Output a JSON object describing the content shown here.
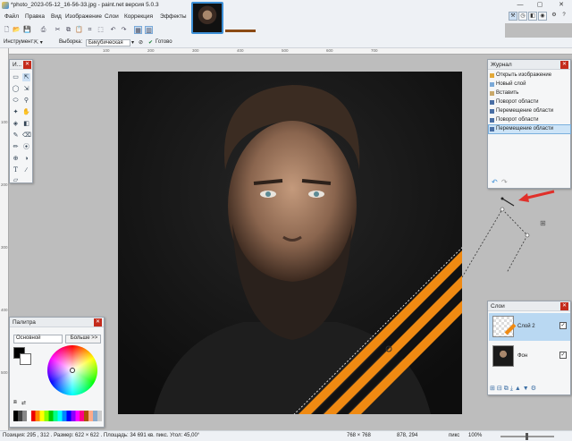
{
  "window": {
    "title": "*photo_2023-05-12_16-56-33.jpg - paint.net версия 5.0.3",
    "min": "—",
    "max": "▢",
    "close": "✕"
  },
  "menu": [
    "Файл",
    "Правка",
    "Вид",
    "Изображение",
    "Слои",
    "Коррекция",
    "Эффекты"
  ],
  "toolbar2": {
    "tool_label": "Инструмент:",
    "tool_value": "⇱ ▾",
    "selection_label": "Выборка:",
    "selection_value": "Бикубическая",
    "done_label": "Готово"
  },
  "history": {
    "title": "Журнал",
    "items": [
      {
        "label": "Открыть изображение",
        "icon": "open-image-icon"
      },
      {
        "label": "Новый слой",
        "icon": "new-layer-icon"
      },
      {
        "label": "Вставить",
        "icon": "paste-icon"
      },
      {
        "label": "Поворот области",
        "icon": "rotate-icon"
      },
      {
        "label": "Перемещение области",
        "icon": "move-icon"
      },
      {
        "label": "Поворот области",
        "icon": "rotate-icon"
      },
      {
        "label": "Перемещение области",
        "icon": "move-icon",
        "selected": true
      }
    ]
  },
  "tools_panel": {
    "title": "И..."
  },
  "layers": {
    "title": "Слои",
    "items": [
      {
        "name": "Слой 2",
        "visible": true,
        "selected": true
      },
      {
        "name": "Фон",
        "visible": true,
        "selected": false
      }
    ]
  },
  "palette": {
    "title": "Палитра",
    "mode": "Основной",
    "more": "Больше >>",
    "primary": "#000000",
    "secondary": "#ffffff"
  },
  "status": {
    "left": "Позиция: 295 , 312 . Размер: 622 × 622 . Площадь: 34 691 кв. пикс. Угол: 45,00°",
    "image_size": "768 × 768",
    "cursor_pos": "878, 294",
    "units": "пикс",
    "zoom": "100%"
  },
  "ruler_top": [
    "100",
    "200",
    "300",
    "400",
    "500",
    "600",
    "700"
  ],
  "ruler_left": [
    "100",
    "200",
    "300",
    "400",
    "500"
  ],
  "colors": {
    "accent": "#3c8fd6",
    "close": "#c42b1c",
    "ribbon_orange": "#f08a12",
    "arrow": "#e0302a"
  }
}
